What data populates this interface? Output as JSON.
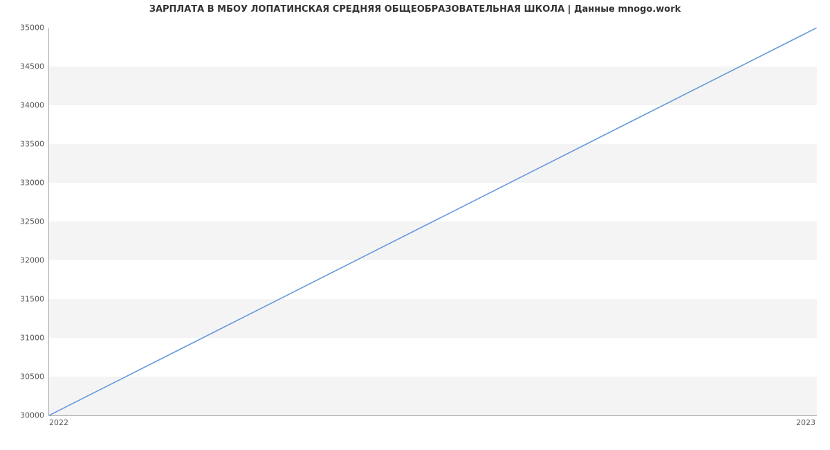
{
  "chart_data": {
    "type": "line",
    "title": "ЗАРПЛАТА В МБОУ ЛОПАТИНСКАЯ СРЕДНЯЯ ОБЩЕОБРАЗОВАТЕЛЬНАЯ ШКОЛА | Данные mnogo.work",
    "x": [
      "2022",
      "2023"
    ],
    "values": [
      30000,
      35000
    ],
    "xlabel": "",
    "ylabel": "",
    "ylim": [
      30000,
      35000
    ],
    "y_ticks": [
      30000,
      30500,
      31000,
      31500,
      32000,
      32500,
      33000,
      33500,
      34000,
      34500,
      35000
    ],
    "x_ticks": [
      "2022",
      "2023"
    ],
    "line_color": "#6699dd"
  }
}
